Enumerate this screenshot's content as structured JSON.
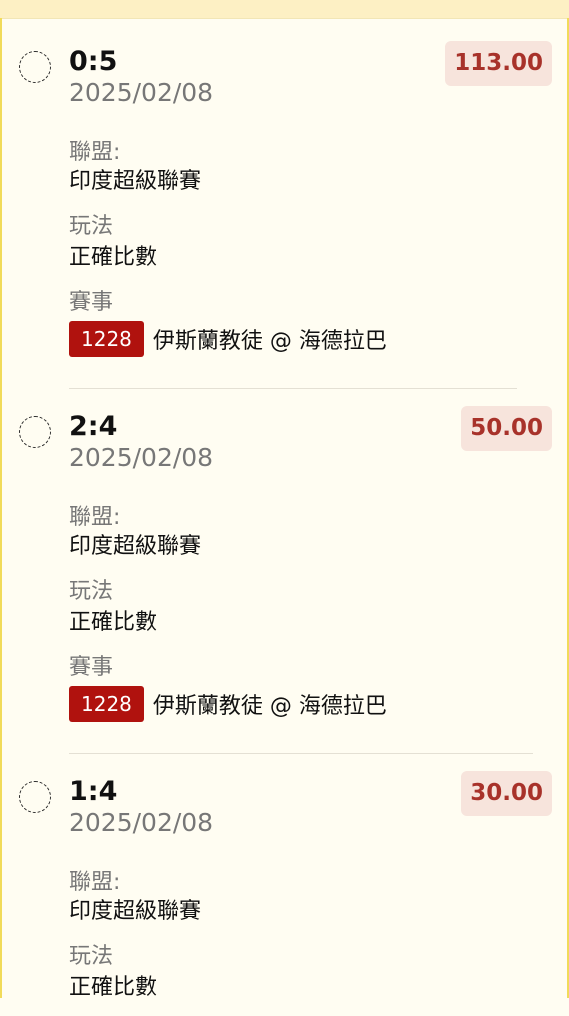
{
  "bets": [
    {
      "selection": "0:5",
      "date": "2025/02/08",
      "odds": "113.00",
      "league_label": "聯盟:",
      "league": "印度超級聯賽",
      "play_label": "玩法",
      "play": "正確比數",
      "event_label": "賽事",
      "match_no": "1228",
      "teams": "伊斯蘭教徒 @ 海德拉巴"
    },
    {
      "selection": "2:4",
      "date": "2025/02/08",
      "odds": "50.00",
      "league_label": "聯盟:",
      "league": "印度超級聯賽",
      "play_label": "玩法",
      "play": "正確比數",
      "event_label": "賽事",
      "match_no": "1228",
      "teams": "伊斯蘭教徒 @ 海德拉巴"
    },
    {
      "selection": "1:4",
      "date": "2025/02/08",
      "odds": "30.00",
      "league_label": "聯盟:",
      "league": "印度超級聯賽",
      "play_label": "玩法",
      "play": "正確比數"
    }
  ],
  "colors": {
    "background": "#fffdf2",
    "odds_text": "#a8322a",
    "odds_bg": "#f7e4dc",
    "match_badge": "#b0120e",
    "frame": "#f1db5a"
  }
}
